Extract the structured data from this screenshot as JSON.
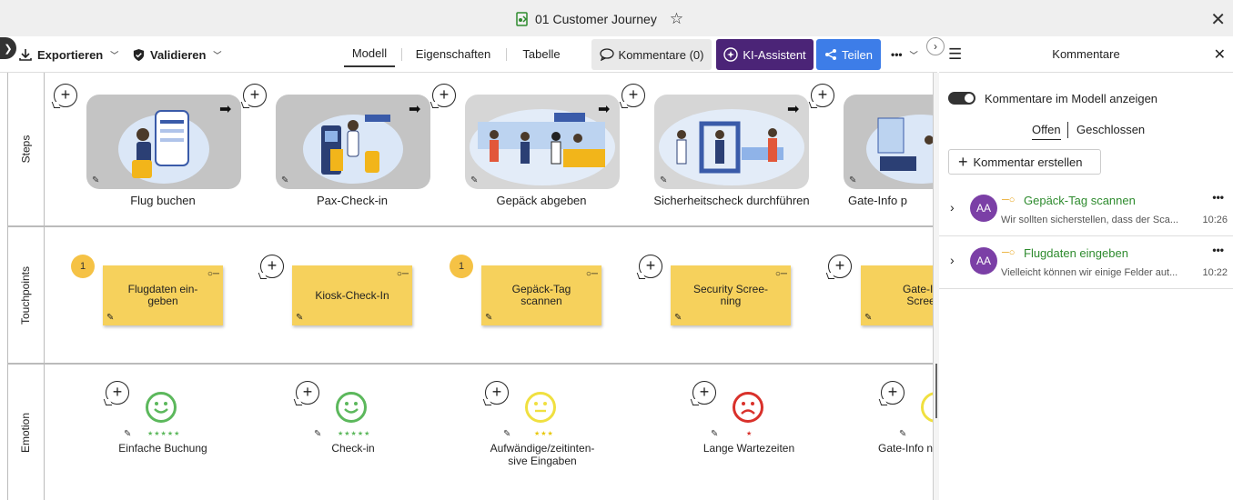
{
  "window": {
    "title": "01 Customer Journey"
  },
  "toolbar": {
    "export_label": "Exportieren",
    "validate_label": "Validieren",
    "tabs": [
      "Modell",
      "Eigenschaften",
      "Tabelle"
    ],
    "comments_label": "Kommentare (0)",
    "ki_label": "KI-Assistent",
    "share_label": "Teilen",
    "more_label": "•••"
  },
  "lanes": [
    "Steps",
    "Touchpoints",
    "Emotion"
  ],
  "steps": [
    "Flug buchen",
    "Pax-Check-in",
    "Gepäck abgeben",
    "Sicherheitscheck durchführen",
    "Gate-Info p"
  ],
  "touchpoints": [
    {
      "label": "Flugdaten ein-\ngeben",
      "badge": "1"
    },
    {
      "label": "Kiosk-Check-In",
      "badge": ""
    },
    {
      "label": "Gepäck-Tag\nscannen",
      "badge": "1"
    },
    {
      "label": "Security Scree-\nning",
      "badge": ""
    },
    {
      "label": "Gate-In\nScree",
      "badge": ""
    }
  ],
  "emotions": [
    {
      "label": "Einfache Buchung",
      "mood": "happy",
      "stars": "★★★★★",
      "color": "#5cb85c"
    },
    {
      "label": "Check-in",
      "mood": "happy",
      "stars": "★★★★★",
      "color": "#5cb85c"
    },
    {
      "label": "Aufwändige/zeitinten-\nsive Eingaben",
      "mood": "neutral",
      "stars": "★★★",
      "color": "#f0e040"
    },
    {
      "label": "Lange Wartezeiten",
      "mood": "sad",
      "stars": "★",
      "color": "#d9312b"
    },
    {
      "label": "Gate-Info n",
      "mood": "neutral",
      "stars": "",
      "color": "#f0e040"
    }
  ],
  "panel": {
    "title": "Kommentare",
    "show_in_model_label": "Kommentare im Modell anzeigen",
    "filter_open": "Offen",
    "filter_closed": "Geschlossen",
    "create_label": "Kommentar erstellen",
    "comments": [
      {
        "initials": "AA",
        "title": "Gepäck-Tag scannen",
        "preview": "Wir sollten sicherstellen, dass der Sca...",
        "time": "10:26"
      },
      {
        "initials": "AA",
        "title": "Flugdaten eingeben",
        "preview": "Vielleicht können wir einige Felder aut...",
        "time": "10:22"
      }
    ]
  },
  "colors": {
    "accent_purple": "#4b2477",
    "share_blue": "#3d7de8",
    "sticky_yellow": "#f6d15c",
    "comment_green": "#2e8b2e"
  }
}
